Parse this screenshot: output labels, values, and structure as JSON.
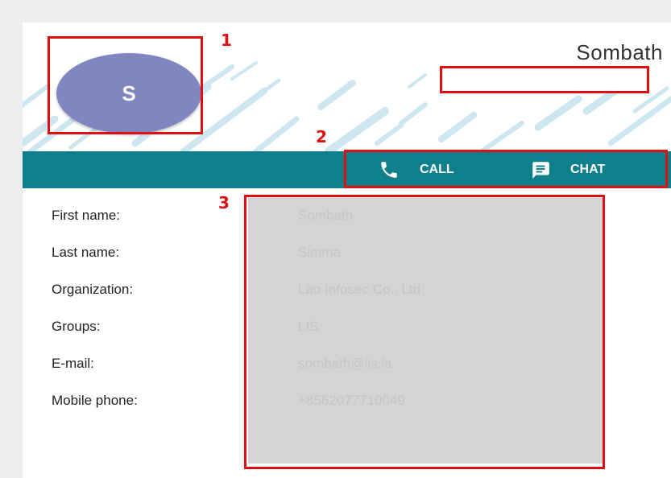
{
  "contact": {
    "initial": "S",
    "display_name": "Sombath",
    "name_field_value": ""
  },
  "actions": {
    "call_label": "CALL",
    "chat_label": "CHAT"
  },
  "fields": [
    {
      "label": "First name:",
      "value": "Sombath"
    },
    {
      "label": "Last name:",
      "value": "Simma"
    },
    {
      "label": "Organization:",
      "value": "Lao Infosec Co., Ltd"
    },
    {
      "label": "Groups:",
      "value": "LIS"
    },
    {
      "label": "E-mail:",
      "value": "sombath@lis.la"
    },
    {
      "label": "Mobile phone:",
      "value": "+8562077710049"
    }
  ],
  "markers": [
    "1",
    "2",
    "3"
  ],
  "colors": {
    "page_background": "#eeeeee",
    "action_bar": "#0f7f8c",
    "avatar": "#7f86c0",
    "highlight": "#e01010",
    "redacted_panel": "#d4d4d4"
  },
  "icons": {
    "call": "phone-icon",
    "chat": "chat-icon"
  }
}
